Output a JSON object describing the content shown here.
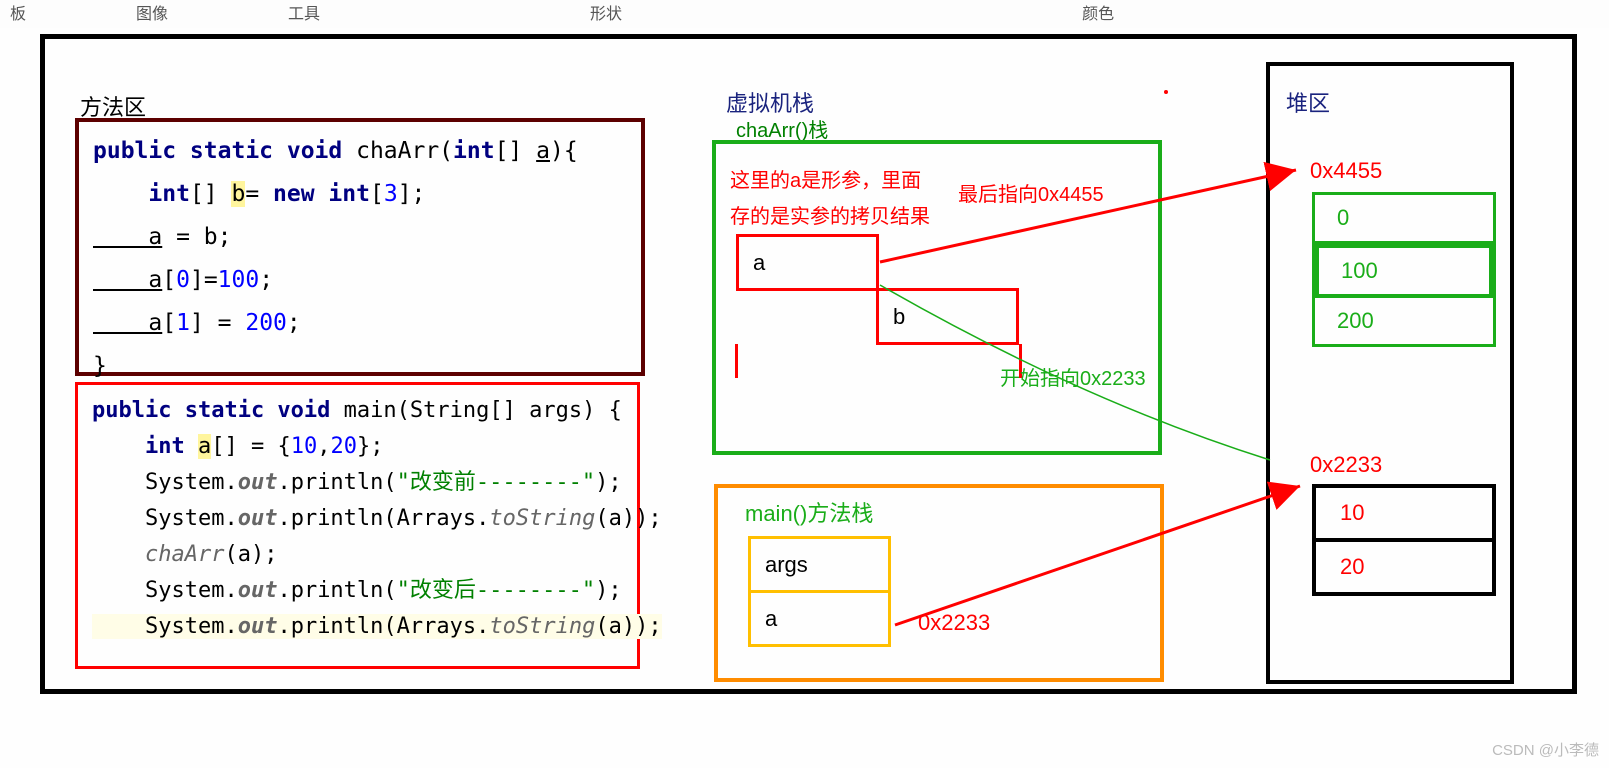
{
  "menubar": {
    "board": "板",
    "image": "图像",
    "tool": "工具",
    "shape": "形状",
    "color": "颜色"
  },
  "method_area": {
    "title": "方法区"
  },
  "code1": {
    "l1a": "public static void",
    "l1b": " chaArr(",
    "l1c": "int",
    "l1d": "[] ",
    "l1e": "a",
    "l1f": "){",
    "l2a": "    int",
    "l2b": "[] ",
    "l2c": "b",
    "l2d": "= ",
    "l2e": "new int",
    "l2f": "[",
    "l2g": "3",
    "l2h": "];",
    "l3a": "    a",
    "l3b": " = b;",
    "l4a": "    a",
    "l4b": "[",
    "l4c": "0",
    "l4d": "]=",
    "l4e": "100",
    "l4f": ";",
    "l5a": "    a",
    "l5b": "[",
    "l5c": "1",
    "l5d": "] = ",
    "l5e": "200",
    "l5f": ";",
    "l6": "}"
  },
  "code2": {
    "l1a": "public static void",
    "l1b": " main(String[] args) {",
    "l2a": "    int ",
    "l2b": "a",
    "l2c": "[] = {",
    "l2d": "10",
    "l2e": ",",
    "l2f": "20",
    "l2g": "};",
    "l3a": "    System.",
    "l3b": "out",
    "l3c": ".println(",
    "l3d": "\"改变前--------\"",
    "l3e": ");",
    "l4a": "    System.",
    "l4b": "out",
    "l4c": ".println(Arrays.",
    "l4d": "toString",
    "l4e": "(a));",
    "l5a": "    ",
    "l5b": "chaArr",
    "l5c": "(a);",
    "l6a": "    System.",
    "l6b": "out",
    "l6c": ".println(",
    "l6d": "\"改变后--------\"",
    "l6e": ");",
    "l7a": "    System.",
    "l7b": "out",
    "l7c": ".println(Arrays.",
    "l7d": "toString",
    "l7e": "(a));"
  },
  "vstack": {
    "title": "虚拟机栈",
    "chaarr": "chaArr()栈",
    "main": "main()方法栈"
  },
  "notes": {
    "n1": "这里的a是形参，里面",
    "n1b": "最后指向0x4455",
    "n2": "存的是实参的拷贝结果",
    "ptr1": "开始指向0x2233",
    "addr_m": "0x2233"
  },
  "heap": {
    "title": "堆区",
    "addr1": "0x4455",
    "cells1": [
      "0",
      "100",
      "200"
    ],
    "addr2": "0x2233",
    "cells2": [
      "10",
      "20"
    ]
  },
  "stack_a": [
    "a",
    "b"
  ],
  "stack_m": [
    "args",
    "a"
  ],
  "watermark": "CSDN @小李德"
}
